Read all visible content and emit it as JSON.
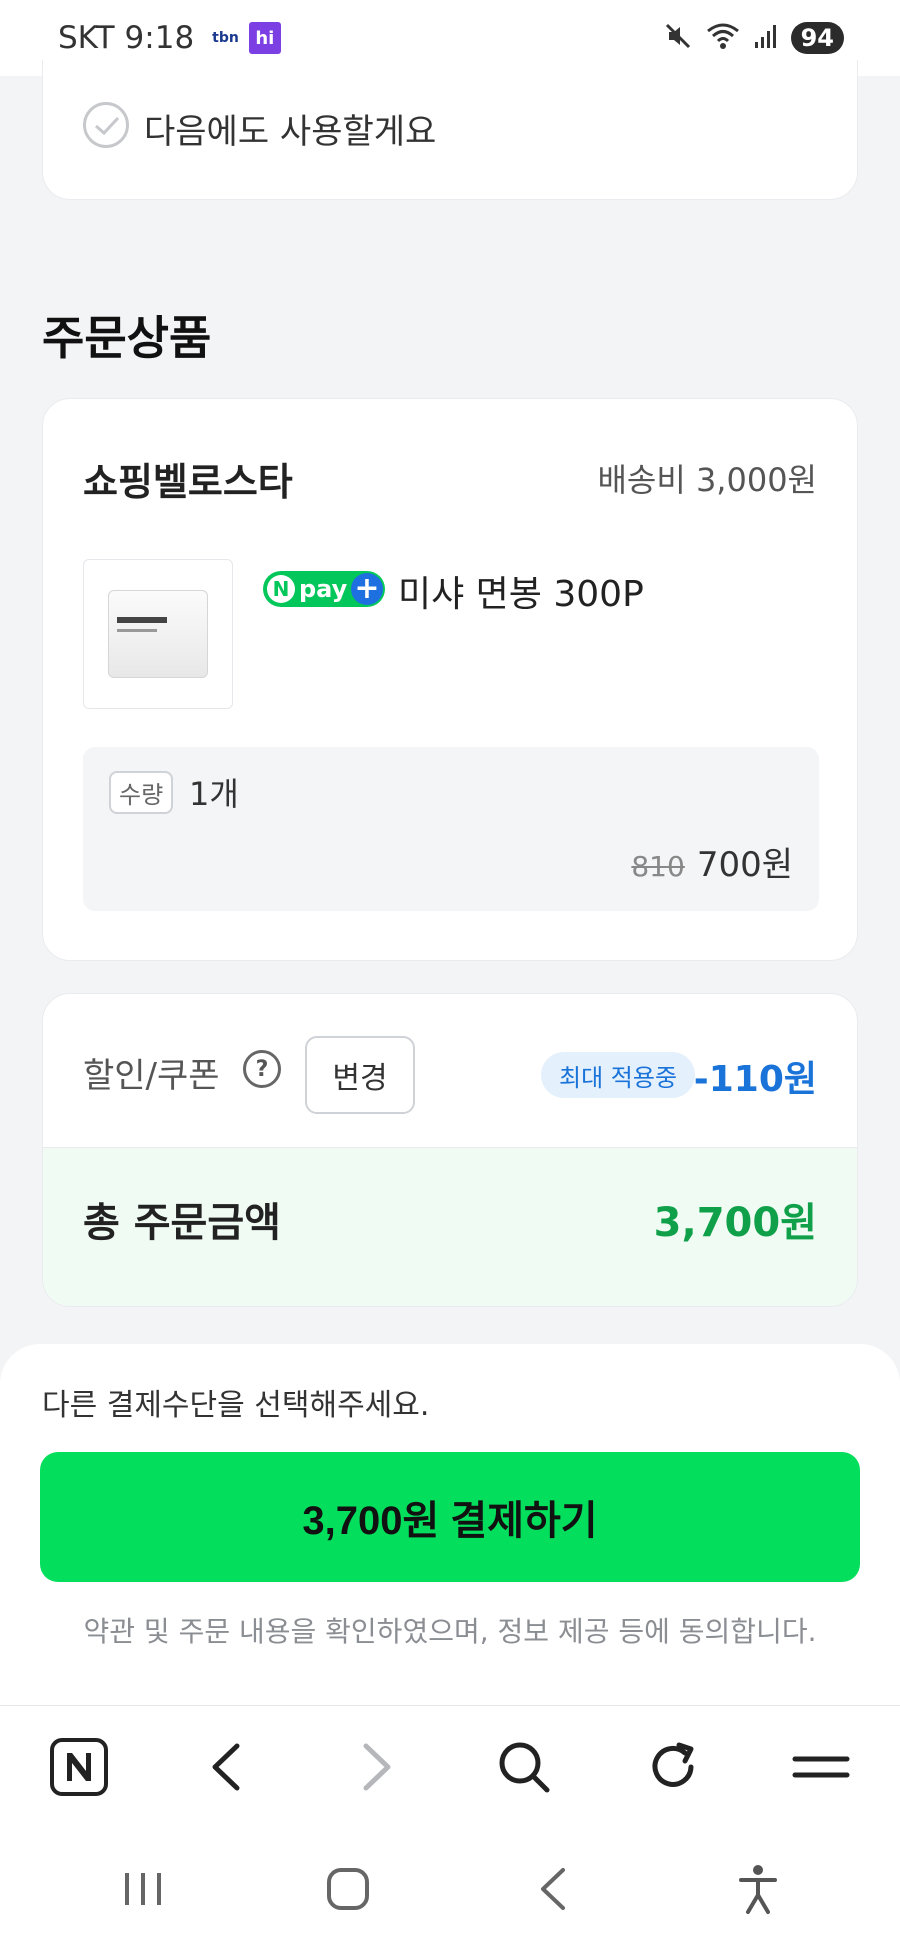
{
  "status_bar": {
    "carrier": "SKT",
    "time": "9:18",
    "carrier_app_label": "tbn",
    "app_icon_label": "hi",
    "battery": "94"
  },
  "reuse": {
    "label": "다음에도 사용할게요"
  },
  "section": {
    "title": "주문상품"
  },
  "order": {
    "seller": "쇼핑벨로스타",
    "shipping": "배송비 3,000원",
    "npay_label": "pay",
    "product_name": "미샤 면봉 300P",
    "qty_tag": "수량",
    "qty_value": "1개",
    "old_price": "810",
    "new_price": "700원"
  },
  "discount": {
    "label": "할인/쿠폰",
    "help": "?",
    "change_button": "변경",
    "badge": "최대 적용중",
    "amount": "-110원",
    "total_label": "총 주문금액",
    "total_value": "3,700원"
  },
  "sheet": {
    "message": "다른 결제수단을 선택해주세요.",
    "pay_button": "3,700원 결제하기",
    "terms": "약관 및 주문 내용을 확인하였으며, 정보 제공 등에 동의합니다."
  },
  "toolbar": {
    "icons": [
      "naver-home-icon",
      "back-icon",
      "forward-icon",
      "search-icon",
      "refresh-icon",
      "menu-icon"
    ]
  },
  "system_nav": {
    "icons": [
      "recent-apps-icon",
      "home-icon",
      "back-icon",
      "accessibility-icon"
    ]
  },
  "colors": {
    "brand_green": "#03de5c",
    "total_green": "#11a04a",
    "discount_blue": "#1a73d9",
    "npay_green": "#03c75a"
  }
}
